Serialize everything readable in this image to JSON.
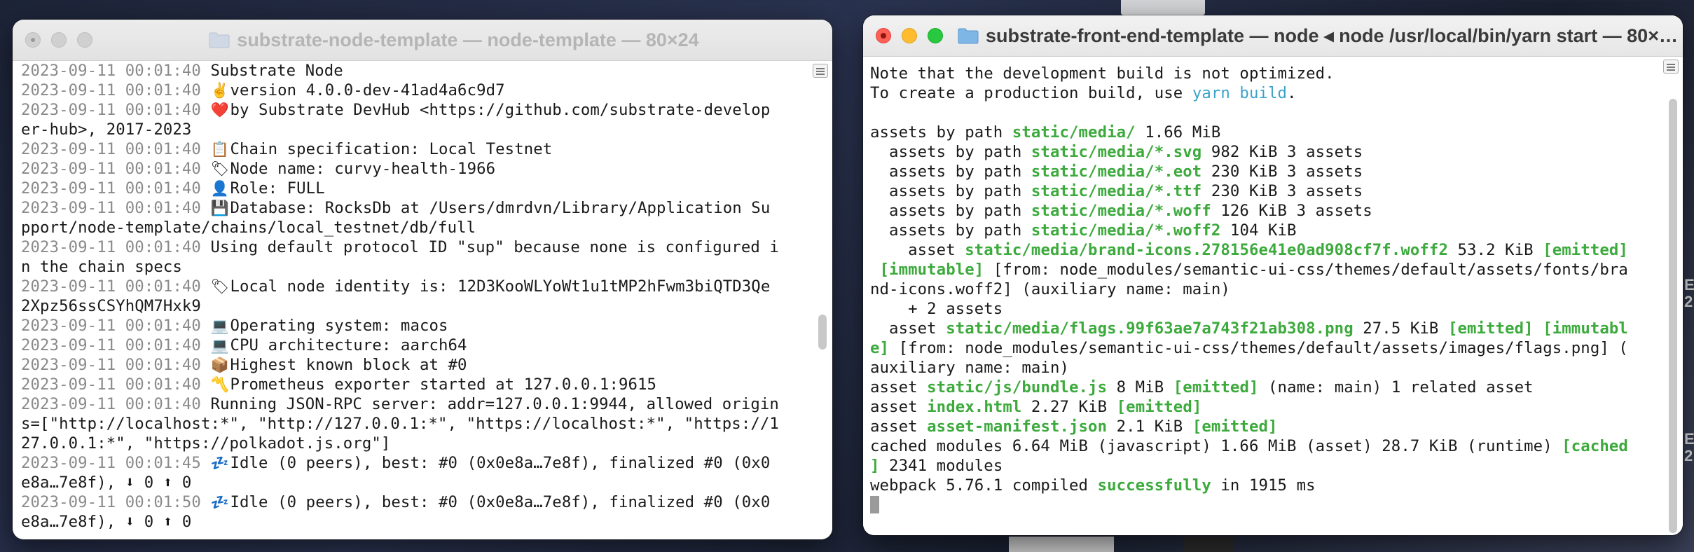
{
  "window_left": {
    "title": "substrate-node-template — node-template — 80×24",
    "lines": [
      {
        "ts": "2023-09-11 00:01:40",
        "icon": "",
        "text": "Substrate Node"
      },
      {
        "ts": "2023-09-11 00:01:40",
        "icon": "✌️",
        "text": "version 4.0.0-dev-41ad4a6c9d7"
      },
      {
        "ts": "2023-09-11 00:01:40",
        "icon": "❤️",
        "text": "by Substrate DevHub <https://github.com/substrate-develop"
      },
      {
        "ts": "",
        "icon": "",
        "text": "er-hub>, 2017-2023"
      },
      {
        "ts": "2023-09-11 00:01:40",
        "icon": "📋",
        "text": "Chain specification: Local Testnet"
      },
      {
        "ts": "2023-09-11 00:01:40",
        "icon": "🏷",
        "text": "Node name: curvy-health-1966"
      },
      {
        "ts": "2023-09-11 00:01:40",
        "icon": "👤",
        "text": "Role: FULL"
      },
      {
        "ts": "2023-09-11 00:01:40",
        "icon": "💾",
        "text": "Database: RocksDb at /Users/dmrdvn/Library/Application Su"
      },
      {
        "ts": "",
        "icon": "",
        "text": "pport/node-template/chains/local_testnet/db/full"
      },
      {
        "ts": "2023-09-11 00:01:40",
        "icon": "",
        "text": "Using default protocol ID \"sup\" because none is configured i"
      },
      {
        "ts": "",
        "icon": "",
        "text": "n the chain specs"
      },
      {
        "ts": "2023-09-11 00:01:40",
        "icon": "🏷",
        "text": "Local node identity is: 12D3KooWLYoWt1u1tMP2hFwm3biQTD3Qe"
      },
      {
        "ts": "",
        "icon": "",
        "text": "2Xpz56ssCSYhQM7Hxk9"
      },
      {
        "ts": "2023-09-11 00:01:40",
        "icon": "💻",
        "text": "Operating system: macos"
      },
      {
        "ts": "2023-09-11 00:01:40",
        "icon": "💻",
        "text": "CPU architecture: aarch64"
      },
      {
        "ts": "2023-09-11 00:01:40",
        "icon": "📦",
        "text": "Highest known block at #0"
      },
      {
        "ts": "2023-09-11 00:01:40",
        "icon": "〽️",
        "text": "Prometheus exporter started at 127.0.0.1:9615"
      },
      {
        "ts": "2023-09-11 00:01:40",
        "icon": "",
        "text": "Running JSON-RPC server: addr=127.0.0.1:9944, allowed origin"
      },
      {
        "ts": "",
        "icon": "",
        "text": "s=[\"http://localhost:*\", \"http://127.0.0.1:*\", \"https://localhost:*\", \"https://1"
      },
      {
        "ts": "",
        "icon": "",
        "text": "27.0.0.1:*\", \"https://polkadot.js.org\"]"
      },
      {
        "ts": "2023-09-11 00:01:45",
        "icon": "💤",
        "text": "Idle (0 peers), best: #0 (0x0e8a…7e8f), finalized #0 (0x0"
      },
      {
        "ts": "",
        "icon": "",
        "text": "e8a…7e8f), ⬇ 0 ⬆ 0"
      },
      {
        "ts": "2023-09-11 00:01:50",
        "icon": "💤",
        "text": "Idle (0 peers), best: #0 (0x0e8a…7e8f), finalized #0 (0x0"
      },
      {
        "ts": "",
        "icon": "",
        "text": "e8a…7e8f), ⬇ 0 ⬆ 0"
      }
    ]
  },
  "window_right": {
    "title": "substrate-front-end-template — node ◂ node /usr/local/bin/yarn start — 80×…",
    "lines": [
      [
        {
          "t": "Note that the development build is not optimized."
        }
      ],
      [
        {
          "t": "To create a production build, use "
        },
        {
          "t": "yarn build",
          "c": "cyan"
        },
        {
          "t": "."
        }
      ],
      [
        {
          "t": ""
        }
      ],
      [
        {
          "t": "assets by path "
        },
        {
          "t": "static/media/",
          "c": "grn"
        },
        {
          "t": " 1.66 MiB"
        }
      ],
      [
        {
          "t": "  assets by path "
        },
        {
          "t": "static/media/*.svg",
          "c": "grn"
        },
        {
          "t": " 982 KiB 3 assets"
        }
      ],
      [
        {
          "t": "  assets by path "
        },
        {
          "t": "static/media/*.eot",
          "c": "grn"
        },
        {
          "t": " 230 KiB 3 assets"
        }
      ],
      [
        {
          "t": "  assets by path "
        },
        {
          "t": "static/media/*.ttf",
          "c": "grn"
        },
        {
          "t": " 230 KiB 3 assets"
        }
      ],
      [
        {
          "t": "  assets by path "
        },
        {
          "t": "static/media/*.woff",
          "c": "grn"
        },
        {
          "t": " 126 KiB 3 assets"
        }
      ],
      [
        {
          "t": "  assets by path "
        },
        {
          "t": "static/media/*.woff2",
          "c": "grn"
        },
        {
          "t": " 104 KiB"
        }
      ],
      [
        {
          "t": "    asset "
        },
        {
          "t": "static/media/brand-icons.278156e41e0ad908cf7f.woff2",
          "c": "grn"
        },
        {
          "t": " 53.2 KiB "
        },
        {
          "t": "[emitted]",
          "c": "grn"
        }
      ],
      [
        {
          "t": " "
        },
        {
          "t": "[immutable]",
          "c": "grn"
        },
        {
          "t": " [from: node_modules/semantic-ui-css/themes/default/assets/fonts/bra"
        }
      ],
      [
        {
          "t": "nd-icons.woff2] (auxiliary name: main)"
        }
      ],
      [
        {
          "t": "    + 2 assets"
        }
      ],
      [
        {
          "t": "  asset "
        },
        {
          "t": "static/media/flags.99f63ae7a743f21ab308.png",
          "c": "grn"
        },
        {
          "t": " 27.5 KiB "
        },
        {
          "t": "[emitted] [immutabl",
          "c": "grn"
        }
      ],
      [
        {
          "t": "e]",
          "c": "grn"
        },
        {
          "t": " [from: node_modules/semantic-ui-css/themes/default/assets/images/flags.png] ("
        }
      ],
      [
        {
          "t": "auxiliary name: main)"
        }
      ],
      [
        {
          "t": "asset "
        },
        {
          "t": "static/js/bundle.js",
          "c": "grn"
        },
        {
          "t": " 8 MiB "
        },
        {
          "t": "[emitted]",
          "c": "grn"
        },
        {
          "t": " (name: main) 1 related asset"
        }
      ],
      [
        {
          "t": "asset "
        },
        {
          "t": "index.html",
          "c": "grn"
        },
        {
          "t": " 2.27 KiB "
        },
        {
          "t": "[emitted]",
          "c": "grn"
        }
      ],
      [
        {
          "t": "asset "
        },
        {
          "t": "asset-manifest.json",
          "c": "grn"
        },
        {
          "t": " 2.1 KiB "
        },
        {
          "t": "[emitted]",
          "c": "grn"
        }
      ],
      [
        {
          "t": "cached modules 6.64 MiB (javascript) 1.66 MiB (asset) 28.7 KiB (runtime) "
        },
        {
          "t": "[cached",
          "c": "grn"
        }
      ],
      [
        {
          "t": "]",
          "c": "grn"
        },
        {
          "t": " 2341 modules"
        }
      ],
      [
        {
          "t": "webpack 5.76.1 compiled "
        },
        {
          "t": "successfully",
          "c": "grn"
        },
        {
          "t": " in 1915 ms"
        }
      ]
    ]
  },
  "desktop_right_edge_text": [
    "E",
    "2:",
    "E",
    "2:"
  ]
}
